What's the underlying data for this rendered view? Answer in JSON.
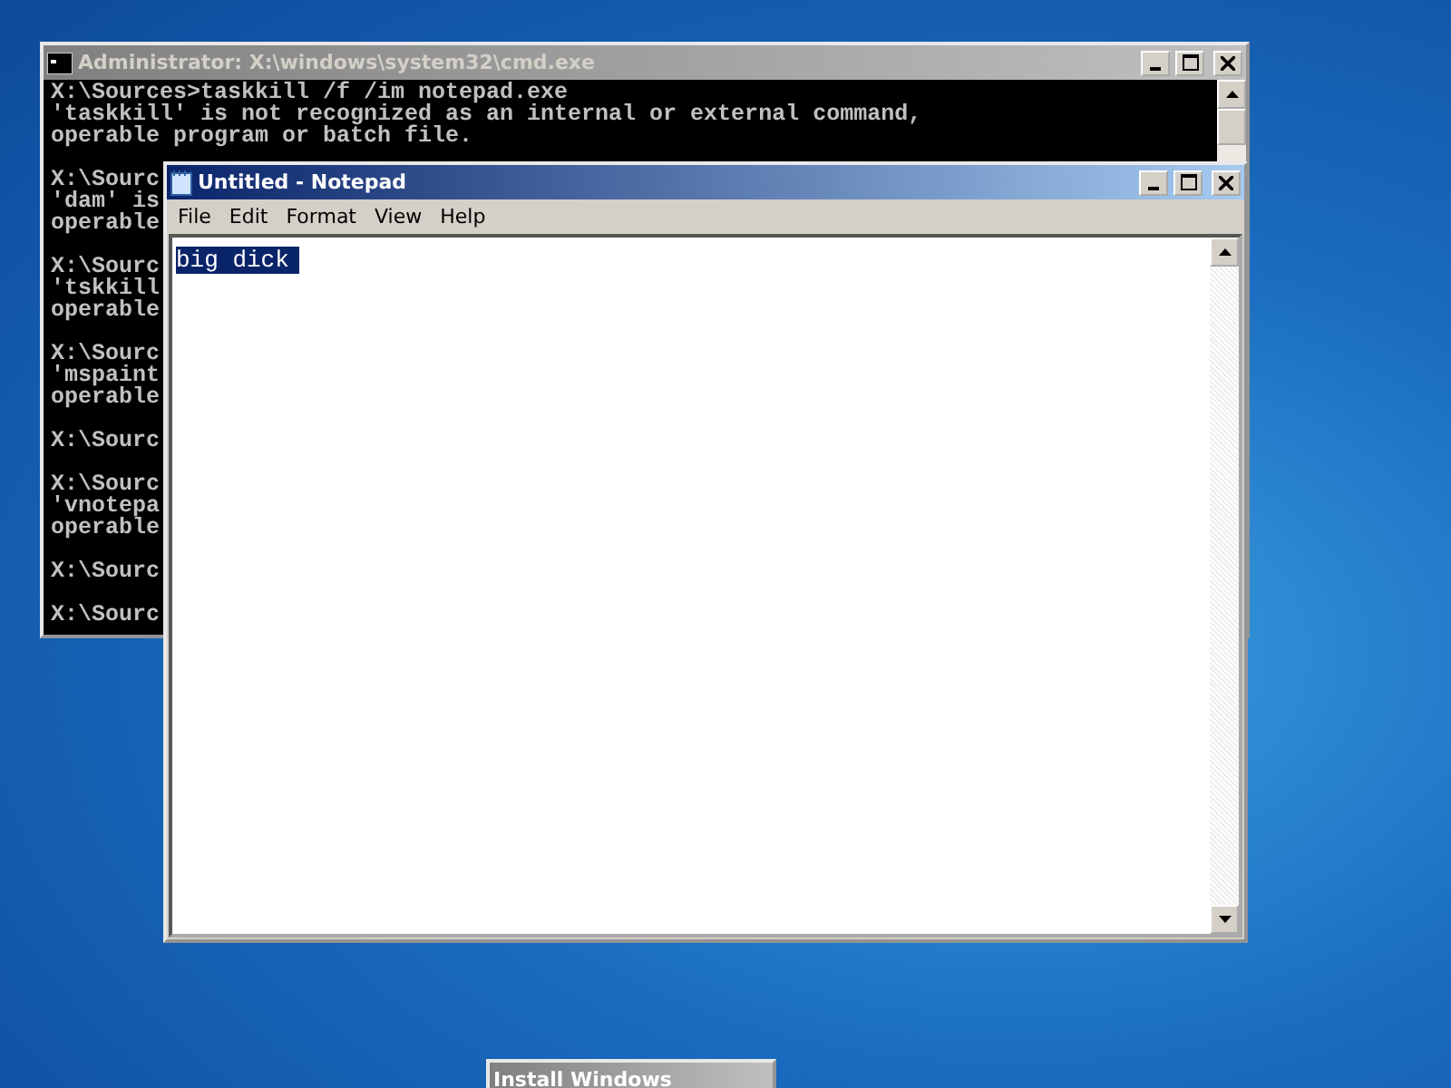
{
  "cmd_window": {
    "title": "Administrator: X:\\windows\\system32\\cmd.exe",
    "active": false,
    "blocks": [
      [
        "X:\\Sources>taskkill /f /im notepad.exe",
        "'taskkill' is not recognized as an internal or external command,",
        "operable program or batch file."
      ],
      [
        "X:\\Sourc",
        "'dam' is",
        "operable"
      ],
      [
        "X:\\Sourc",
        "'tskkill",
        "operable"
      ],
      [
        "X:\\Sourc",
        "'mspaint",
        "operable"
      ],
      [
        "X:\\Sourc"
      ],
      [
        "X:\\Sourc",
        "'vnotepa",
        "operable"
      ],
      [
        "X:\\Sourc"
      ],
      [
        "X:\\Sourc"
      ]
    ]
  },
  "notepad_window": {
    "title": "Untitled - Notepad",
    "active": true,
    "menu": [
      "File",
      "Edit",
      "Format",
      "View",
      "Help"
    ],
    "text": "big dick",
    "text_selected": true
  },
  "setup_window": {
    "title": "Install Windows"
  }
}
